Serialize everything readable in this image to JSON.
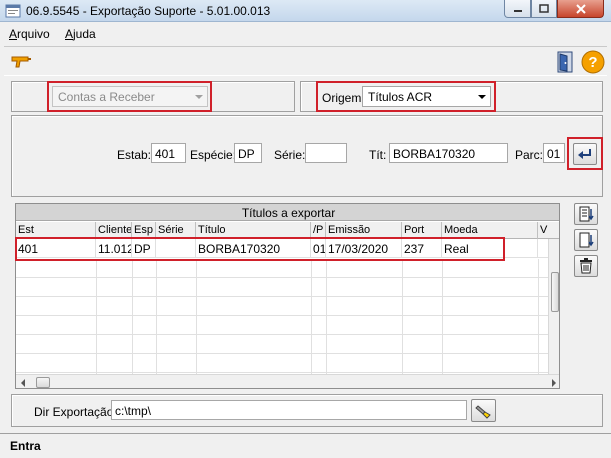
{
  "window": {
    "title": "06.9.5545 - Exportação Suporte - 5.01.00.013"
  },
  "menu": {
    "items": [
      {
        "label": "Arquivo",
        "accel": "A",
        "rest": "rquivo"
      },
      {
        "label": "Ajuda",
        "accel": "A",
        "rest": "juda"
      }
    ]
  },
  "module": {
    "value": "Contas a Receber"
  },
  "origem": {
    "label": "Origem:",
    "value": "Títulos ACR"
  },
  "filters": {
    "estab_label": "Estab:",
    "estab": "401",
    "especie_label": "Espécie:",
    "especie": "DP",
    "serie_label": "Série:",
    "serie": "",
    "titulo_label": "Tít:",
    "titulo": "BORBA170320",
    "parcela_label": "Parc:",
    "parcela": "01"
  },
  "grid": {
    "caption": "Títulos a exportar",
    "columns": [
      "Est",
      "Cliente",
      "Esp",
      "Série",
      "Título",
      "/P",
      "Emissão",
      "Port",
      "Moeda",
      "V"
    ],
    "rows": [
      {
        "est": "401",
        "cliente": "11.012",
        "esp": "DP",
        "serie": "",
        "titulo": "BORBA170320",
        "parcela": "01",
        "emissao": "17/03/2020",
        "port": "237",
        "moeda": "Real"
      }
    ]
  },
  "export": {
    "label": "Dir Exportação:",
    "path": "c:\\tmp\\"
  },
  "status": {
    "text": "Entra"
  },
  "colors": {
    "highlight": "#d0202a",
    "help_icon": "#f5a000"
  }
}
